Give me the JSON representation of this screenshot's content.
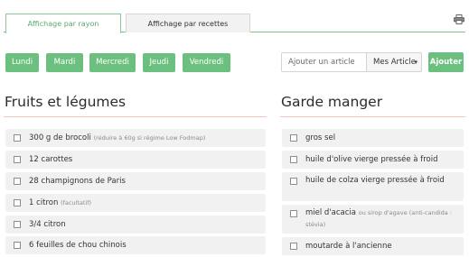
{
  "tabs": [
    {
      "label": "Affichage par rayon",
      "active": true
    },
    {
      "label": "Affichage par recettes",
      "active": false
    }
  ],
  "icons": {
    "print": "printer-icon",
    "select_chevron": "chevron-down-icon"
  },
  "days": [
    "Lundi",
    "Mardi",
    "Mercredi",
    "Jeudi",
    "Vendredi"
  ],
  "add_article": {
    "placeholder": "Ajouter un article",
    "select_value": "Mes Article",
    "button_label": "Ajouter"
  },
  "colors": {
    "accent": "#6cc07f",
    "rule": "#f2c6be",
    "item_bg": "#f1f1f1"
  },
  "sections": {
    "fruits": {
      "title": "Fruits et légumes",
      "items": [
        {
          "text": "300 g de brocoli",
          "note": "(réduire à 60g si régime Low Fodmap)"
        },
        {
          "text": "12 carottes",
          "note": ""
        },
        {
          "text": "28 champignons de Paris",
          "note": ""
        },
        {
          "text": "1 citron",
          "note": "(facultatif)"
        },
        {
          "text": "3/4 citron",
          "note": ""
        },
        {
          "text": "6 feuilles de chou chinois",
          "note": ""
        }
      ]
    },
    "garde_manger": {
      "title": "Garde manger",
      "items": [
        {
          "text": "gros sel",
          "note": ""
        },
        {
          "text": "huile d'olive vierge pressée à froid",
          "note": ""
        },
        {
          "text": "huile de colza vierge pressée à froid",
          "note": ""
        },
        {
          "text": "miel d'acacia",
          "note": "ou sirop d'agave (anti-candida : stévia)"
        },
        {
          "text": "moutarde à l'ancienne",
          "note": ""
        }
      ]
    }
  }
}
